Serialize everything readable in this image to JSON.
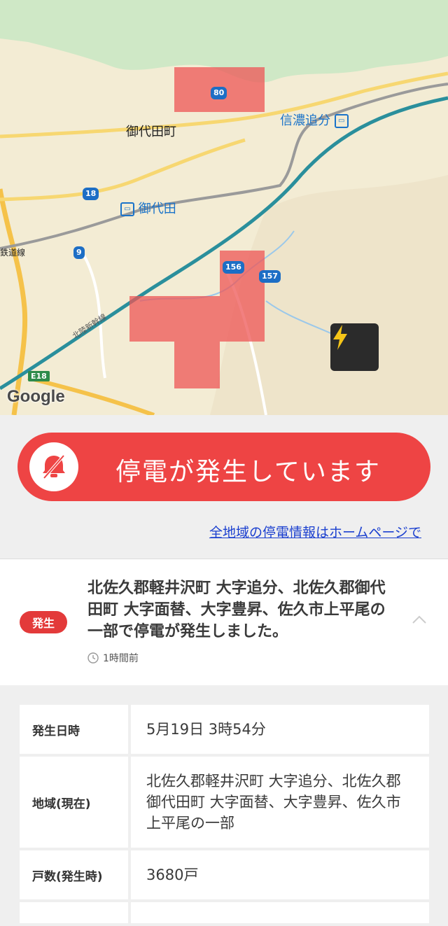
{
  "map": {
    "labels": {
      "miyota_town": "御代田町",
      "miyota_station": "御代田",
      "shinano_oiwake": "信濃追分",
      "railway_line": "鉄道線",
      "shinkansen": "北陸新幹線"
    },
    "routes": [
      "80",
      "18",
      "9",
      "156",
      "157"
    ],
    "expressway": "E18",
    "google_logo": "Google",
    "bolt_icon": "lightning-bolt-icon"
  },
  "banner": {
    "text": "停電が発生しています",
    "icon": "power-off-icon",
    "color": "#ee4444"
  },
  "homepage_link": "全地域の停電情報はホームページで",
  "event": {
    "badge": "発生",
    "description": "北佐久郡軽井沢町 大字追分、北佐久郡御代田町 大字面替、大字豊昇、佐久市上平尾の一部で停電が発生しました。",
    "time_ago": "1時間前"
  },
  "details": {
    "rows": [
      {
        "label": "発生日時",
        "value": "5月19日 3時54分"
      },
      {
        "label": "地域(現在)",
        "value": "北佐久郡軽井沢町 大字追分、北佐久郡御代田町 大字面替、大字豊昇、佐久市 上平尾の一部"
      },
      {
        "label": "戸数(発生時)",
        "value": "3680戸"
      },
      {
        "label": "",
        "value": ""
      }
    ]
  }
}
